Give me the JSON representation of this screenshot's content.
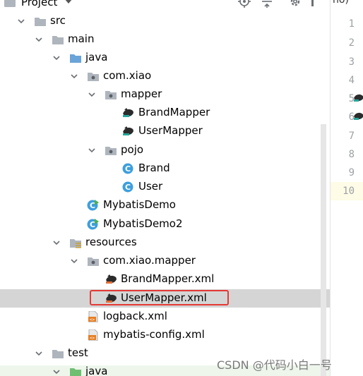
{
  "header": {
    "project_label": "Project",
    "tab_partial": "no)"
  },
  "gutter": {
    "line_numbers": [
      "1",
      "2",
      "3",
      "4",
      "5",
      "6",
      "7",
      "8",
      "9",
      "10"
    ]
  },
  "tree": {
    "src": "src",
    "main": "main",
    "java": "java",
    "pkg": "com.xiao",
    "mapper": "mapper",
    "brand_mapper": "BrandMapper",
    "user_mapper": "UserMapper",
    "pojo": "pojo",
    "brand": "Brand",
    "user": "User",
    "mybatis_demo": "MybatisDemo",
    "mybatis_demo2": "MybatisDemo2",
    "resources": "resources",
    "res_pkg": "com.xiao.mapper",
    "brand_mapper_xml": "BrandMapper.xml",
    "user_mapper_xml": "UserMapper.xml",
    "logback_xml": "logback.xml",
    "mybatis_config_xml": "mybatis-config.xml",
    "test": "test",
    "test_java": "java"
  },
  "watermark": "CSDN @代码小白一号",
  "colors": {
    "folder": "#afb5bd",
    "source_folder": "#6aa4d8",
    "package_dot": "#5a5f66",
    "class_icon": "#3d9fdd",
    "main_class_arrow": "#4caf50",
    "highlight_box": "#e53935",
    "selection": "#d5d5d5"
  }
}
